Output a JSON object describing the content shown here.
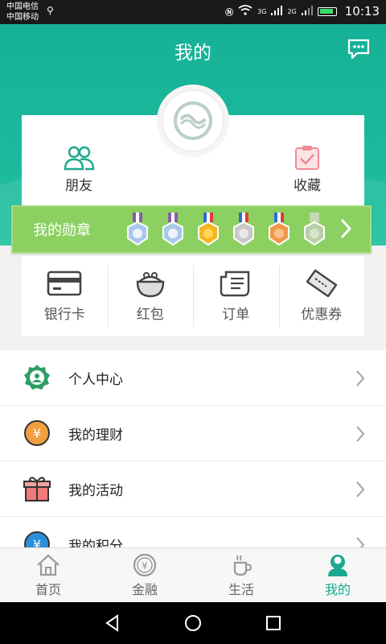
{
  "status_bar": {
    "carrier_1": "中国电信",
    "carrier_2": "中国移动",
    "net_1": "3G",
    "net_2": "2G",
    "time": "10:13"
  },
  "header": {
    "title": "我的"
  },
  "profile_card": {
    "friends_label": "朋友",
    "favorites_label": "收藏"
  },
  "medals": {
    "label": "我的勋章",
    "items": [
      "medal-purple-blue",
      "medal-purple-blue",
      "medal-gold",
      "medal-silver",
      "medal-orange",
      "medal-gray"
    ]
  },
  "wallet": {
    "items": [
      {
        "label": "银行卡",
        "icon": "bank-card-icon"
      },
      {
        "label": "红包",
        "icon": "purse-icon"
      },
      {
        "label": "订单",
        "icon": "receipt-icon"
      },
      {
        "label": "优惠券",
        "icon": "ticket-icon"
      }
    ]
  },
  "menu": {
    "items": [
      {
        "label": "个人中心",
        "icon": "user-center-icon",
        "color": "#2e9e64"
      },
      {
        "label": "我的理财",
        "icon": "finance-icon",
        "color": "#f0a040"
      },
      {
        "label": "我的活动",
        "icon": "gift-icon",
        "color": "#f07a7a"
      },
      {
        "label": "我的积分",
        "icon": "points-icon",
        "color": "#2a8fd8"
      }
    ]
  },
  "tabs": [
    {
      "label": "首页",
      "icon": "home-icon"
    },
    {
      "label": "金融",
      "icon": "finance-tab-icon"
    },
    {
      "label": "生活",
      "icon": "coffee-icon"
    },
    {
      "label": "我的",
      "icon": "profile-icon",
      "active": true
    }
  ],
  "colors": {
    "brand": "#1aa88e",
    "medal_bar": "#8bd061"
  }
}
